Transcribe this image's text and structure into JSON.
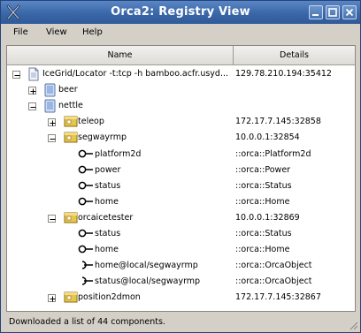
{
  "window": {
    "title": "Orca2: Registry View"
  },
  "titlebar": {
    "icons": [
      "app-x-icon",
      "minimize-icon",
      "maximize-icon",
      "close-icon"
    ]
  },
  "menu": {
    "file": "File",
    "view": "View",
    "help": "Help"
  },
  "table": {
    "col_name": "Name",
    "col_details": "Details"
  },
  "tree": [
    {
      "label": "IceGrid/Locator -t:tcp -h bamboo.acfr.usyd...",
      "details": "129.78.210.194:35412",
      "indent": 0,
      "expander": "minus",
      "icon": "page-icon"
    },
    {
      "label": "beer",
      "details": "",
      "indent": 1,
      "expander": "plus",
      "icon": "computer-icon"
    },
    {
      "label": "nettle",
      "details": "",
      "indent": 1,
      "expander": "minus",
      "icon": "computer-icon"
    },
    {
      "label": "teleop",
      "details": "172.17.7.145:32858",
      "indent": 2,
      "expander": "plus",
      "icon": "component-icon"
    },
    {
      "label": "segwayrmp",
      "details": "10.0.0.1:32854",
      "indent": 2,
      "expander": "minus",
      "icon": "component-icon"
    },
    {
      "label": "platform2d",
      "details": "::orca::Platform2d",
      "indent": 3,
      "expander": "none",
      "icon": "provided-interface-icon"
    },
    {
      "label": "power",
      "details": "::orca::Power",
      "indent": 3,
      "expander": "none",
      "icon": "provided-interface-icon"
    },
    {
      "label": "status",
      "details": "::orca::Status",
      "indent": 3,
      "expander": "none",
      "icon": "provided-interface-icon"
    },
    {
      "label": "home",
      "details": "::orca::Home",
      "indent": 3,
      "expander": "none",
      "icon": "provided-interface-icon"
    },
    {
      "label": "orcaicetester",
      "details": "10.0.0.1:32869",
      "indent": 2,
      "expander": "minus",
      "icon": "component-icon"
    },
    {
      "label": "status",
      "details": "::orca::Status",
      "indent": 3,
      "expander": "none",
      "icon": "provided-interface-icon"
    },
    {
      "label": "home",
      "details": "::orca::Home",
      "indent": 3,
      "expander": "none",
      "icon": "provided-interface-icon"
    },
    {
      "label": "home@local/segwayrmp",
      "details": "::orca::OrcaObject",
      "indent": 3,
      "expander": "none",
      "icon": "required-interface-icon"
    },
    {
      "label": "status@local/segwayrmp",
      "details": "::orca::OrcaObject",
      "indent": 3,
      "expander": "none",
      "icon": "required-interface-icon"
    },
    {
      "label": "position2dmon",
      "details": "172.17.7.145:32867",
      "indent": 2,
      "expander": "plus",
      "icon": "component-icon"
    }
  ],
  "status": {
    "text": "Downloaded a list of 44 components."
  },
  "colors": {
    "titlebar": "#3a67a8",
    "window_bg": "#d4d0c8",
    "folder_yellow": "#e8c64a",
    "computer_blue": "#7fa7dc"
  }
}
